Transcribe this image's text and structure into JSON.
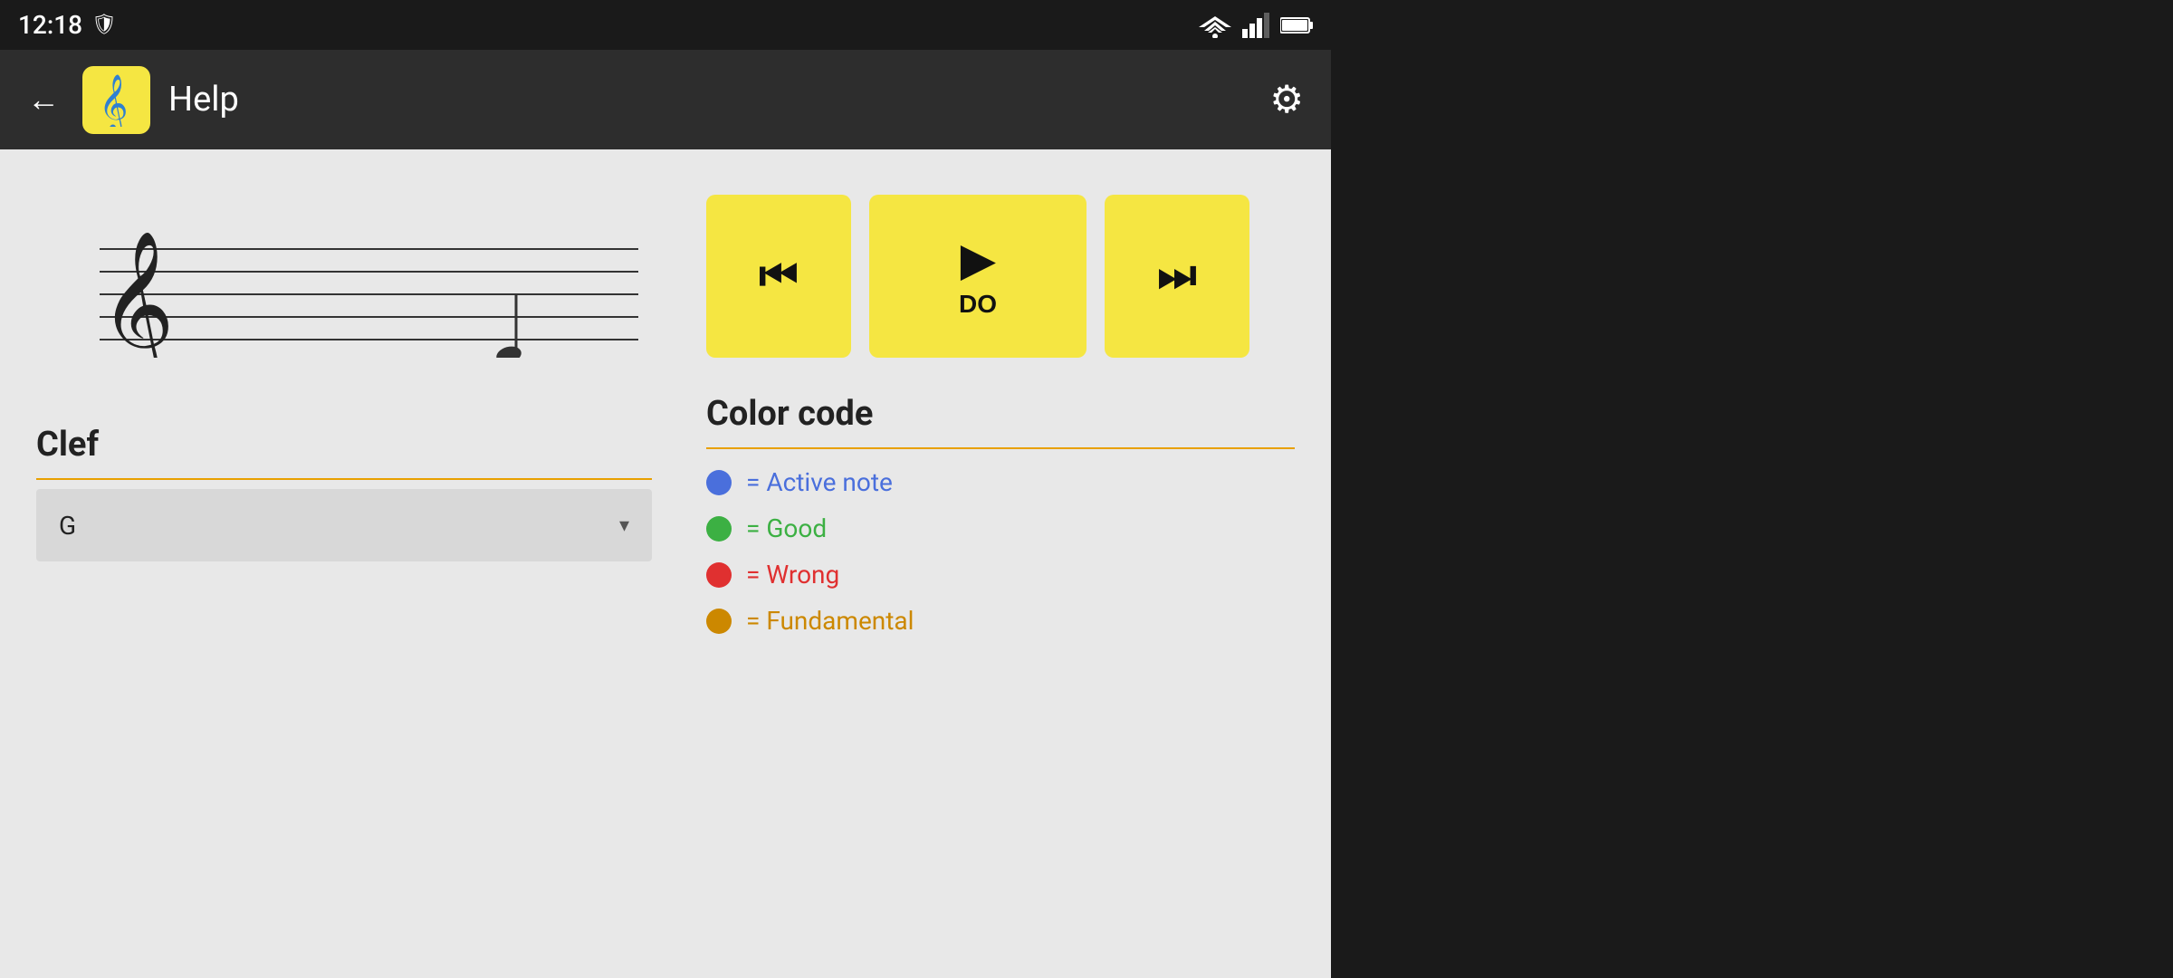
{
  "statusBar": {
    "time": "12:18",
    "icon": "🛡",
    "signals": [
      "▼",
      "▲",
      "🔋"
    ]
  },
  "topBar": {
    "backLabel": "←",
    "appIconSymbol": "𝄞",
    "title": "Help",
    "settingsSymbol": "⚙"
  },
  "leftPanel": {
    "clef": {
      "title": "Clef",
      "selectedValue": "G",
      "dropdownArrow": "▾"
    }
  },
  "rightPanel": {
    "playback": {
      "prevIcon": "⏮",
      "playIcon": "▶",
      "playLabel": "DO",
      "nextIcon": "⏭"
    },
    "colorCode": {
      "title": "Color code",
      "items": [
        {
          "color": "blue",
          "symbol": "●",
          "label": "= Active note"
        },
        {
          "color": "green",
          "symbol": "●",
          "label": "= Good"
        },
        {
          "color": "red",
          "symbol": "●",
          "label": "= Wrong"
        },
        {
          "color": "orange",
          "symbol": "●",
          "label": "= Fundamental"
        }
      ]
    }
  }
}
